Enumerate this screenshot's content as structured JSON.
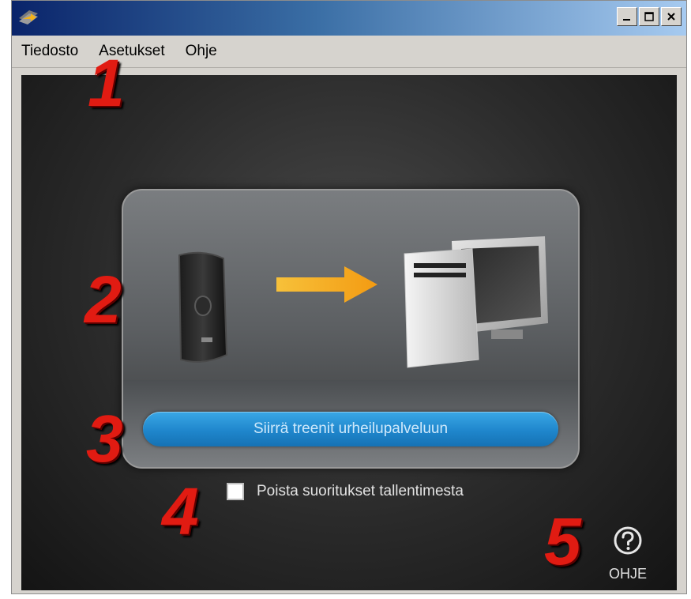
{
  "menu": {
    "items": [
      {
        "label": "Tiedosto"
      },
      {
        "label": "Asetukset"
      },
      {
        "label": "Ohje"
      }
    ]
  },
  "titlebar": {
    "buttons": [
      "minimize",
      "maximize",
      "close"
    ]
  },
  "main": {
    "transfer_button_label": "Siirrä treenit urheilupalveluun",
    "delete_checkbox": {
      "label": "Poista suoritukset tallentimesta",
      "checked": false
    },
    "help": {
      "label": "OHJE"
    }
  },
  "annotations": {
    "n1": "1",
    "n2": "2",
    "n3": "3",
    "n4": "4",
    "n5": "5"
  },
  "colors": {
    "accent_button": "#1f86cc",
    "arrow": "#f5a623",
    "annotation_red": "#e11b12"
  },
  "icons": {
    "app": "app-logo-icon",
    "device": "training-recorder-device",
    "transfer": "arrow-right-icon",
    "computer": "desktop-computer-icon",
    "help": "question-circle-icon"
  }
}
